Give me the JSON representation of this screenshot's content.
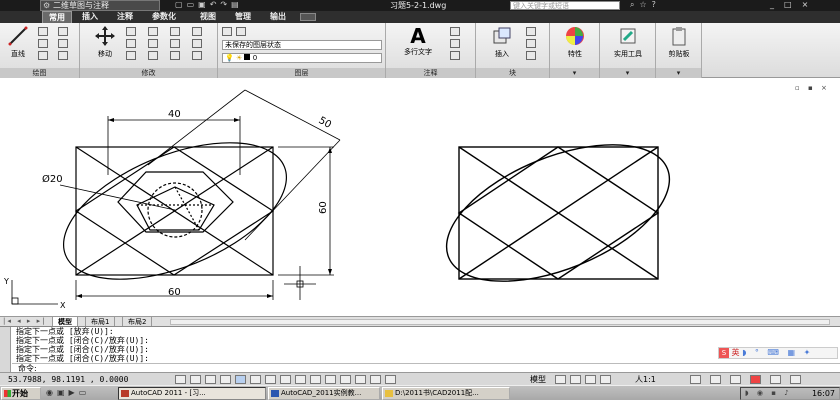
{
  "titlebar": {
    "workspace": "二维草图与注释",
    "filename": "习题5-2-1.dwg",
    "search_placeholder": "键入关键字或短语"
  },
  "ribbon_tabs": [
    "常用",
    "插入",
    "注释",
    "参数化",
    "视图",
    "管理",
    "输出"
  ],
  "ribbon": {
    "draw": {
      "title": "绘图",
      "line_label": "直线"
    },
    "modify": {
      "title": "修改",
      "move_label": "移动"
    },
    "layers": {
      "title": "图层",
      "state": "未保存的图层状态",
      "current": "0"
    },
    "annotation": {
      "title": "注释",
      "mtext_label": "多行文字"
    },
    "block": {
      "title": "块",
      "insert_label": "插入"
    },
    "properties": {
      "label": "特性"
    },
    "utilities": {
      "label": "实用工具"
    },
    "clipboard": {
      "label": "剪贴板"
    }
  },
  "drawing": {
    "dim_top": "40",
    "dim_diag": "50",
    "dim_diameter": "Ø20",
    "dim_right": "60",
    "dim_bottom": "60",
    "ucs_x": "X",
    "ucs_y": "Y"
  },
  "layout_tabs": [
    "模型",
    "布局1",
    "布局2"
  ],
  "cmdline": {
    "lines": [
      "指定下一点或 [放弃(U)]:",
      "指定下一点或 [闭合(C)/放弃(U)]:",
      "指定下一点或 [闭合(C)/放弃(U)]:",
      "指定下一点或 [闭合(C)/放弃(U)]:"
    ],
    "prompt": "命令:",
    "ime_label": "英"
  },
  "statusbar": {
    "coords": "53.7988,  98.1191 , 0.0000",
    "model": "模型",
    "scale": "人1:1"
  },
  "taskbar": {
    "start": "开始",
    "tasks": [
      "AutoCAD 2011 - [习...",
      "AutoCAD_2011实例教...",
      "D:\\2011书\\CAD2011配..."
    ],
    "clock": "16:07"
  },
  "colors": {
    "titlebar": "#1b1b1b",
    "ribbon_tab_bar": "#2e2e2e",
    "accent_red": "#b83a2a"
  }
}
